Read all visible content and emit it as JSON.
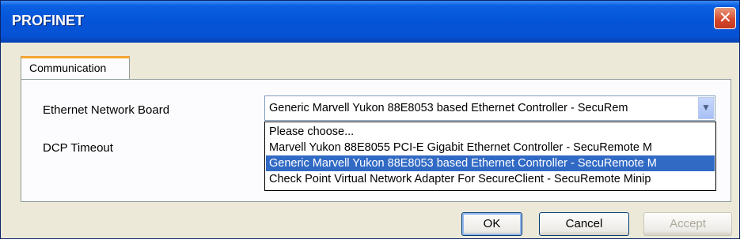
{
  "window": {
    "title": "PROFINET",
    "close_glyph": "✕"
  },
  "tabs": [
    {
      "label": "Communication"
    }
  ],
  "form": {
    "ethernet_label": "Ethernet Network Board",
    "ethernet_value": "Generic Marvell Yukon 88E8053 based Ethernet Controller - SecuRem",
    "dcp_label": "DCP Timeout",
    "dropdown_options": [
      "Please choose...",
      "Marvell Yukon 88E8055 PCI-E Gigabit Ethernet Controller - SecuRemote M",
      "Generic Marvell Yukon 88E8053 based Ethernet Controller - SecuRemote M",
      "Check Point Virtual Network Adapter For SecureClient - SecuRemote Minip"
    ],
    "selected_index": 2
  },
  "buttons": {
    "ok": "OK",
    "cancel": "Cancel",
    "accept": "Accept"
  },
  "colors": {
    "titlebar": "#0554d8",
    "selection": "#316ac5",
    "tab_highlight": "#f7a531"
  },
  "icons": {
    "close": "close-icon",
    "dropdown": "chevron-down-icon"
  }
}
